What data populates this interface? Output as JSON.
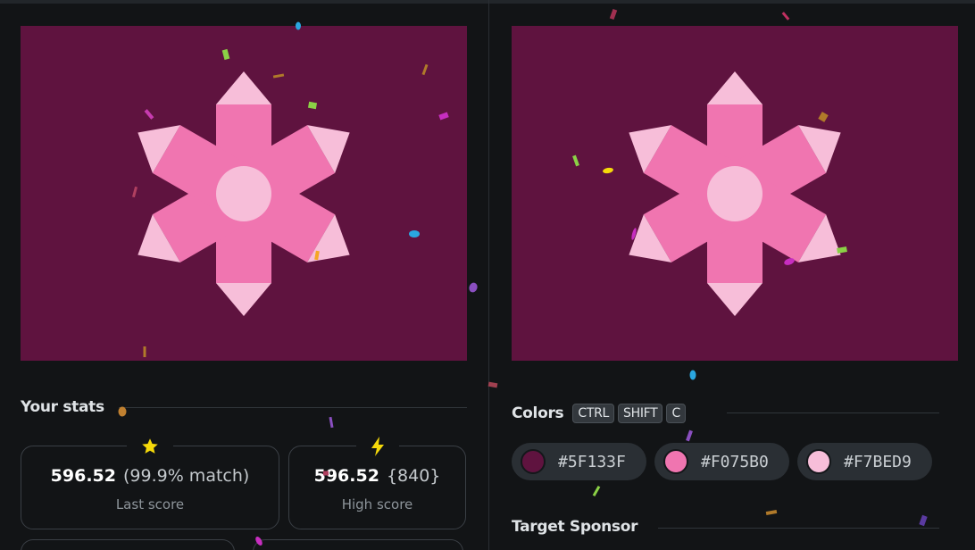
{
  "colors": {
    "background": "#5F133F",
    "primary": "#F075B0",
    "secondary": "#F7BED9"
  },
  "stats": {
    "heading": "Your stats",
    "last": {
      "icon": "star-icon",
      "score": "596.52",
      "detail": "(99.9% match)",
      "label": "Last score"
    },
    "high": {
      "icon": "lightning-icon",
      "score": "596.52",
      "detail": "{840}",
      "label": "High score"
    }
  },
  "palette": {
    "heading": "Colors",
    "shortcut": [
      "CTRL",
      "SHIFT",
      "C"
    ],
    "swatches": [
      {
        "hex": "#5F133F"
      },
      {
        "hex": "#F075B0"
      },
      {
        "hex": "#F7BED9"
      }
    ]
  },
  "sponsor": {
    "heading": "Target Sponsor"
  }
}
